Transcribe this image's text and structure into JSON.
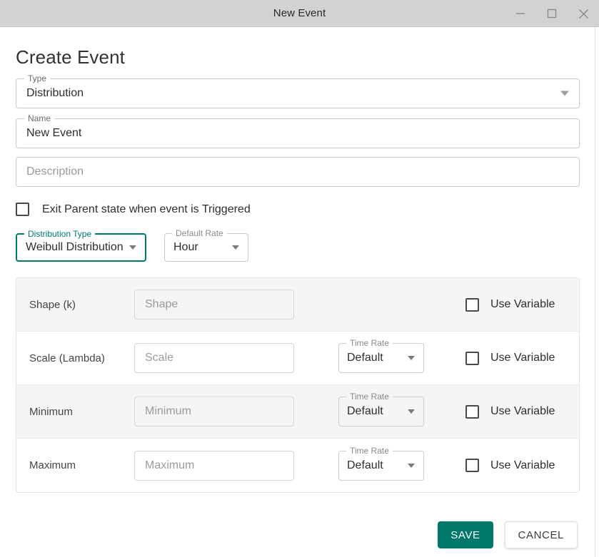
{
  "window": {
    "title": "New Event",
    "controls": [
      {
        "name": "minimize",
        "label": "–"
      },
      {
        "name": "maximize",
        "label": "□"
      },
      {
        "name": "close",
        "label": "✕"
      }
    ]
  },
  "page": {
    "heading": "Create Event"
  },
  "form": {
    "type": {
      "label": "Type",
      "value": "Distribution"
    },
    "name": {
      "label": "Name",
      "value": "New Event"
    },
    "description": {
      "label": "",
      "placeholder": "Description",
      "value": ""
    },
    "exit_parent": {
      "label": "Exit Parent state when event is Triggered",
      "checked": false
    },
    "distribution_type": {
      "label": "Distribution Type",
      "value": "Weibull Distribution",
      "focused": true,
      "accent": "#00796b"
    },
    "default_rate": {
      "label": "Default Rate",
      "value": "Hour"
    }
  },
  "parameters": {
    "use_variable_label": "Use Variable",
    "time_rate_label": "Time Rate",
    "rows": [
      {
        "name": "Shape (k)",
        "placeholder": "Shape",
        "value": "",
        "has_time_rate": false,
        "time_rate": "",
        "use_variable": false
      },
      {
        "name": "Scale (Lambda)",
        "placeholder": "Scale",
        "value": "",
        "has_time_rate": true,
        "time_rate": "Default",
        "use_variable": false
      },
      {
        "name": "Minimum",
        "placeholder": "Minimum",
        "value": "",
        "has_time_rate": true,
        "time_rate": "Default",
        "use_variable": false
      },
      {
        "name": "Maximum",
        "placeholder": "Maximum",
        "value": "",
        "has_time_rate": true,
        "time_rate": "Default",
        "use_variable": false
      }
    ]
  },
  "footer": {
    "save_label": "SAVE",
    "cancel_label": "CANCEL",
    "save_color": "#00796b"
  }
}
